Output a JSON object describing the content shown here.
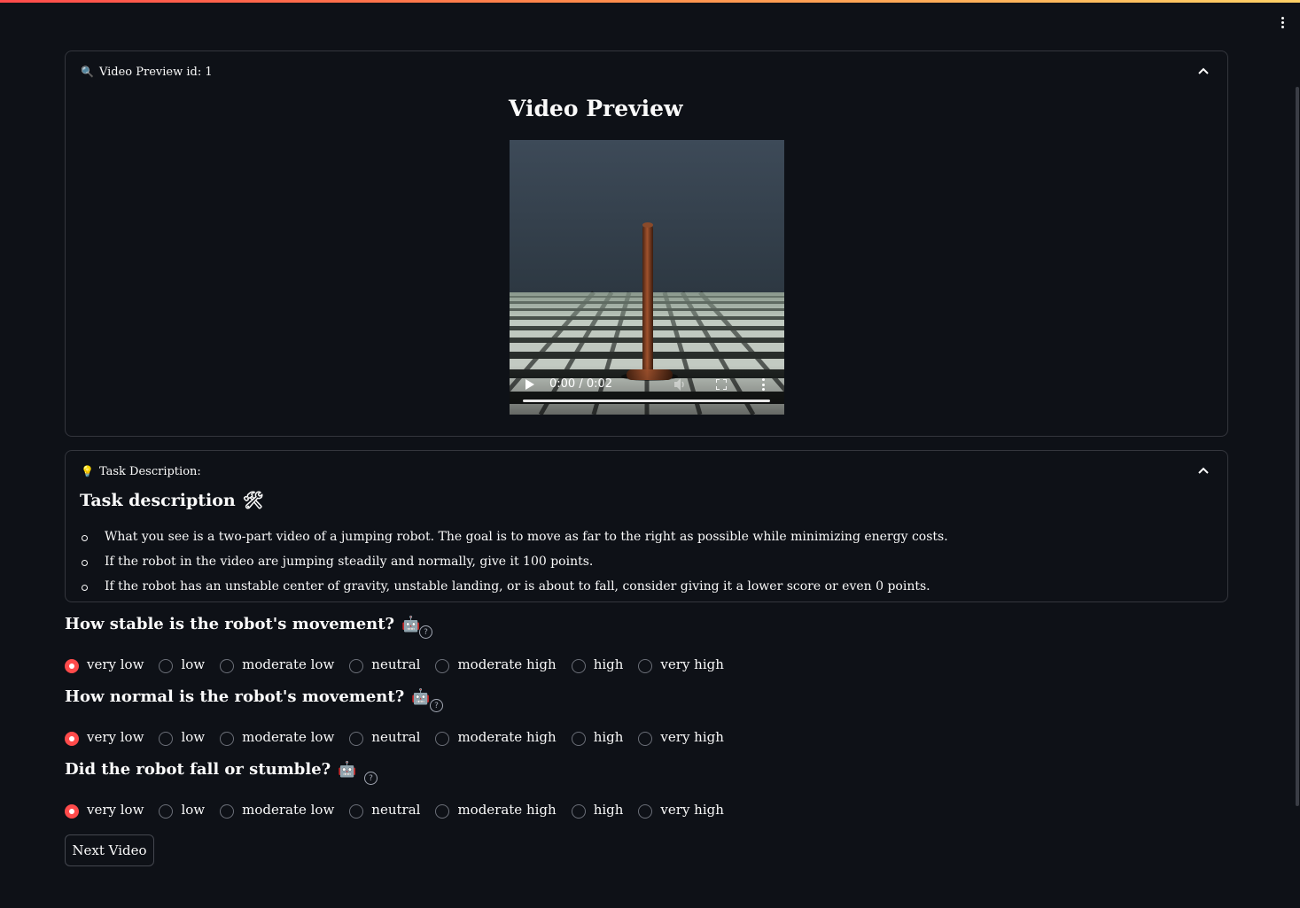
{
  "app": {
    "accent_color": "#ff4b4b",
    "background_color": "#0e1117"
  },
  "preview_expander": {
    "icon": "magnifier-icon",
    "label": "Video Preview id: 1",
    "title": "Video Preview",
    "video": {
      "time": "0:00 / 0:02",
      "progress": 0.0
    }
  },
  "task_expander": {
    "icon": "lightbulb-icon",
    "label": "Task Description:",
    "title": "Task description",
    "title_icon": "🛠",
    "items": [
      "What you see is a two-part video of a jumping robot. The goal is to move as far to the right as possible while minimizing energy costs.",
      "If the robot in the video are jumping steadily and normally, give it 100 points.",
      "If the robot has an unstable center of gravity, unstable landing, or is about to fall, consider giving it a lower score or even 0 points."
    ]
  },
  "options": [
    "very low",
    "low",
    "moderate low",
    "neutral",
    "moderate high",
    "high",
    "very high"
  ],
  "questions": [
    {
      "label": "How stable is the robot's movement?",
      "emoji": "🤖",
      "selected": "very low"
    },
    {
      "label": "How normal is the robot's movement?",
      "emoji": "🤖",
      "selected": "very low"
    },
    {
      "label": "Did the robot fall or stumble?",
      "emoji": "🤖",
      "selected": "very low"
    }
  ],
  "next_button": "Next Video"
}
